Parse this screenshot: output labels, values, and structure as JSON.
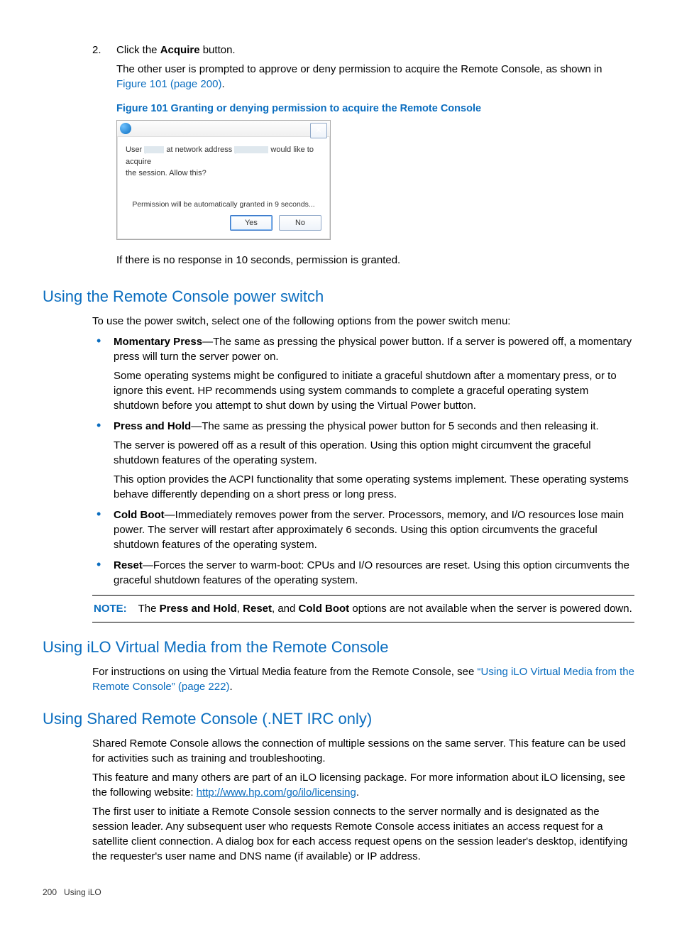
{
  "step2": {
    "num": "2.",
    "line_pre": "Click the ",
    "line_bold": "Acquire",
    "line_post": " button.",
    "para_pre": "The other user is prompted to approve or deny permission to acquire the Remote Console, as shown in ",
    "para_link": "Figure 101 (page 200)",
    "para_post": "."
  },
  "figure": {
    "caption": "Figure 101 Granting or denying permission to acquire the Remote Console",
    "msg_user": "User",
    "msg_at": "at network address",
    "msg_tail": "would like to acquire",
    "msg_line2": "the session. Allow this?",
    "auto": "Permission will be automatically granted in 9 seconds...",
    "yes": "Yes",
    "no": "No",
    "close": "✕"
  },
  "after_dialog": "If there is no response in 10 seconds, permission is granted.",
  "h_power": "Using the Remote Console power switch",
  "power_intro": "To use the power switch, select one of the following options from the power switch menu:",
  "bullets": [
    {
      "bold": "Momentary Press",
      "rest": "—The same as pressing the physical power button. If a server is powered off, a momentary press will turn the server power on.",
      "paras": [
        "Some operating systems might be configured to initiate a graceful shutdown after a momentary press, or to ignore this event. HP recommends using system commands to complete a graceful operating system shutdown before you attempt to shut down by using the Virtual Power button."
      ]
    },
    {
      "bold": "Press and Hold",
      "rest": "—The same as pressing the physical power button for 5 seconds and then releasing it.",
      "paras": [
        "The server is powered off as a result of this operation. Using this option might circumvent the graceful shutdown features of the operating system.",
        "This option provides the ACPI functionality that some operating systems implement. These operating systems behave differently depending on a short press or long press."
      ]
    },
    {
      "bold": "Cold Boot",
      "rest": "—Immediately removes power from the server. Processors, memory, and I/O resources lose main power. The server will restart after approximately 6 seconds. Using this option circumvents the graceful shutdown features of the operating system.",
      "paras": []
    },
    {
      "bold": "Reset",
      "rest": "—Forces the server to warm-boot: CPUs and I/O resources are reset. Using this option circumvents the graceful shutdown features of the operating system.",
      "paras": []
    }
  ],
  "note": {
    "label": "NOTE:",
    "pre": "The ",
    "b1": "Press and Hold",
    "sep1": ", ",
    "b2": "Reset",
    "sep2": ", and ",
    "b3": "Cold Boot",
    "post": " options are not available when the server is powered down."
  },
  "h_vm": "Using iLO Virtual Media from the Remote Console",
  "vm_pre": "For instructions on using the Virtual Media feature from the Remote Console, see ",
  "vm_link": "“Using iLO Virtual Media from the Remote Console” (page 222)",
  "vm_post": ".",
  "h_shared": "Using Shared Remote Console (.NET IRC only)",
  "shared_p1": "Shared Remote Console allows the connection of multiple sessions on the same server. This feature can be used for activities such as training and troubleshooting.",
  "shared_p2_pre": "This feature and many others are part of an iLO licensing package. For more information about iLO licensing, see the following website: ",
  "shared_p2_url": "http://www.hp.com/go/ilo/licensing",
  "shared_p2_post": ".",
  "shared_p3": "The first user to initiate a Remote Console session connects to the server normally and is designated as the session leader. Any subsequent user who requests Remote Console access initiates an access request for a satellite client connection. A dialog box for each access request opens on the session leader's desktop, identifying the requester's user name and DNS name (if available) or IP address.",
  "footer": {
    "page": "200",
    "section": "Using iLO"
  }
}
